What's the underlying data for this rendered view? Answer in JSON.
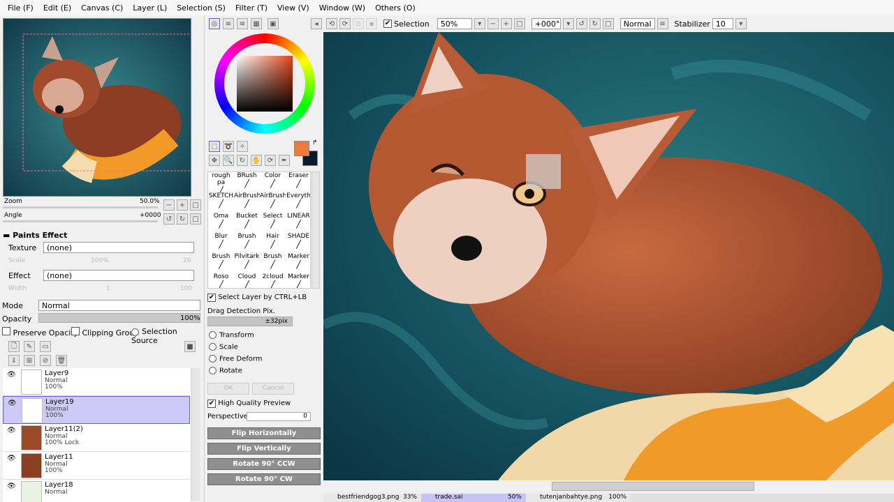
{
  "menu": [
    "File (F)",
    "Edit (E)",
    "Canvas (C)",
    "Layer (L)",
    "Selection (S)",
    "Filter (T)",
    "View (V)",
    "Window (W)",
    "Others (O)"
  ],
  "toolbar": {
    "selection_label": "Selection",
    "zoom": "50%",
    "angle": "+000°",
    "blend": "Normal",
    "stabilizer_label": "Stabilizer",
    "stabilizer_value": "10"
  },
  "navigator": {
    "zoom_label": "Zoom",
    "zoom_value": "50.0%",
    "angle_label": "Angle",
    "angle_value": "+0000"
  },
  "paints_effect": {
    "header": "Paints Effect",
    "texture_label": "Texture",
    "texture_value": "(none)",
    "scale_label": "Scale",
    "scale_value": "100%",
    "scale_num": "20",
    "effect_label": "Effect",
    "effect_value": "(none)",
    "width_label": "Width",
    "width_value": "1",
    "width_num": "100"
  },
  "layer_props": {
    "mode_label": "Mode",
    "mode_value": "Normal",
    "opacity_label": "Opacity",
    "opacity_value": "100%",
    "preserve_opacity": "Preserve Opacity",
    "clipping_group": "Clipping Group",
    "selection_source": "Selection Source"
  },
  "layers": [
    {
      "name": "Layer9",
      "mode": "Normal",
      "opacity": "100%",
      "active": false
    },
    {
      "name": "Layer19",
      "mode": "Normal",
      "opacity": "100%",
      "active": true
    },
    {
      "name": "Layer11(2)",
      "mode": "Normal",
      "opacity": "100% Lock",
      "active": false
    },
    {
      "name": "Layer11",
      "mode": "Normal",
      "opacity": "100%",
      "active": false
    },
    {
      "name": "Layer18",
      "mode": "Normal",
      "opacity": "",
      "active": false
    }
  ],
  "brushes": [
    [
      "rough pa",
      "BRush",
      "Color",
      "Eraser"
    ],
    [
      "SKETCH",
      "AirBrush",
      "AirBrush",
      "Everyth"
    ],
    [
      "Oma",
      "Bucket",
      "Select",
      "LINEAR"
    ],
    [
      "Blur",
      "Brush",
      "Hair",
      "SHADE"
    ],
    [
      "Brush",
      "Pilvitark",
      "Brush",
      "Marker"
    ],
    [
      "Roso",
      "Cloud",
      "2cloud",
      "Marker"
    ]
  ],
  "transform": {
    "select_layer": "Select Layer by CTRL+LB",
    "drag_detect": "Drag Detection Pix.",
    "drag_value": "±32pix",
    "options": [
      "Transform",
      "Scale",
      "Free Deform",
      "Rotate"
    ],
    "ok": "OK",
    "cancel": "Cancel",
    "hq_preview": "High Quality Preview",
    "perspective_label": "Perspective",
    "perspective_value": "0"
  },
  "buttons": [
    "Flip Horizontally",
    "Flip Vertically",
    "Rotate 90° CCW",
    "Rotate 90° CW"
  ],
  "colors": {
    "primary": "#f07a3c",
    "secondary": "#0a1a2a"
  },
  "status_tabs": [
    {
      "name": "bestfriendgog3.png",
      "zoom": "33%"
    },
    {
      "name": "trade.sai",
      "zoom": "50%"
    },
    {
      "name": "tutenjanbahtye.png",
      "zoom": "100%"
    }
  ]
}
